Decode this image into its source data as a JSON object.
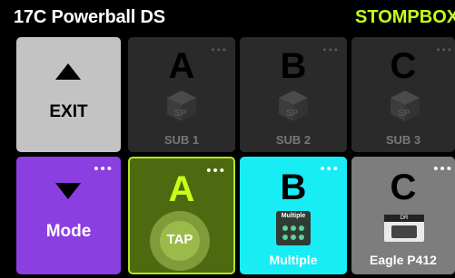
{
  "header": {
    "preset_name": "17C Powerball DS",
    "mode_name": "STOMPBOX"
  },
  "top_row": {
    "exit": {
      "label": "EXIT",
      "icon": "up-triangle-icon"
    },
    "subs": [
      {
        "letter": "A",
        "label": "SUB 1",
        "icon": "sp-cube-icon"
      },
      {
        "letter": "B",
        "label": "SUB 2",
        "icon": "sp-cube-icon"
      },
      {
        "letter": "C",
        "label": "SUB 3",
        "icon": "sp-cube-icon"
      }
    ]
  },
  "bottom_row": {
    "mode": {
      "label": "Mode",
      "icon": "down-triangle-icon"
    },
    "tap": {
      "letter": "A",
      "label": "TAP"
    },
    "multiple": {
      "letter": "B",
      "label": "Multiple",
      "pedal_text": "Multiple"
    },
    "amp": {
      "letter": "C",
      "label": "Eagle P412",
      "amp_text": "DR"
    }
  },
  "colors": {
    "mode_accent": "#c6ff1a",
    "exit_tile": "#c3c3c3",
    "sub_tile": "#2a2a2a",
    "mode_tile": "#8b3fe0",
    "tap_tile": "#4e6a10",
    "tap_border": "#b5e61d",
    "multiple_tile": "#18ecf5",
    "amp_tile": "#7d7d7d"
  }
}
